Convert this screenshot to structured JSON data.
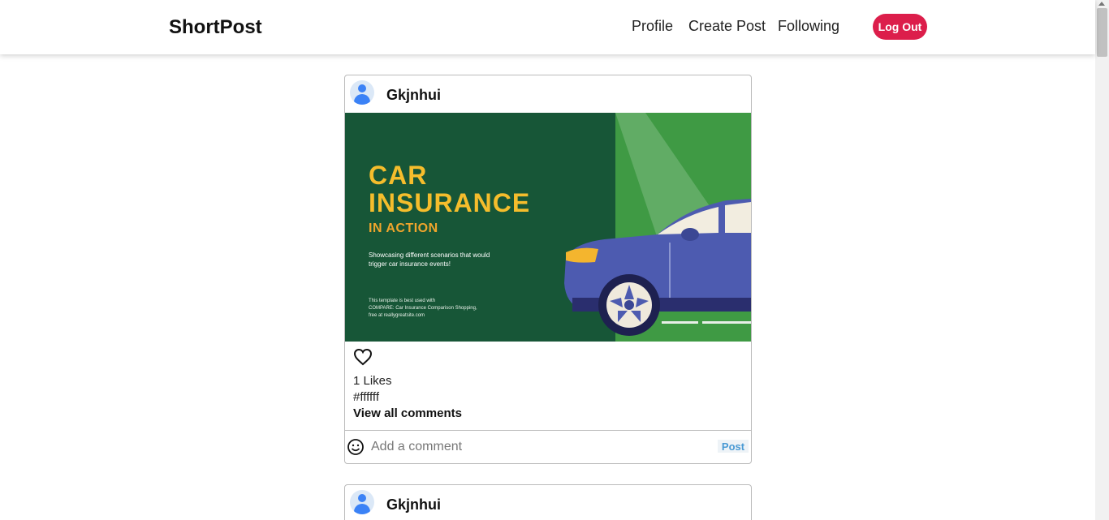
{
  "app": {
    "brand": "ShortPost"
  },
  "nav": {
    "profile": "Profile",
    "create_post": "Create Post",
    "following": "Following",
    "logout": "Log Out"
  },
  "colors": {
    "logout_bg": "#dc1e4b",
    "post_button": "#4a9ad4",
    "image_dark_green": "#175637",
    "image_light_green": "#3f9a44",
    "image_title": "#f5bd2c"
  },
  "posts": [
    {
      "username": "Gkjnhui",
      "image": {
        "title_line1": "CAR",
        "title_line2": "INSURANCE",
        "subtitle": "IN ACTION",
        "description": "Showcasing different scenarios that would trigger car insurance events!",
        "note_line1": "This template is best used with",
        "note_line2": "COMPARE: Car Insurance Comparison Shopping,",
        "note_line3": "free at reallygreatsite.com"
      },
      "likes": "1 Likes",
      "caption": "#ffffff",
      "view_comments": "View all comments",
      "comment_placeholder": "Add a comment",
      "post_button": "Post",
      "icons": {
        "like": "heart-icon",
        "emoji": "smiley-icon",
        "avatar": "user-avatar-icon"
      }
    },
    {
      "username": "Gkjnhui"
    }
  ]
}
